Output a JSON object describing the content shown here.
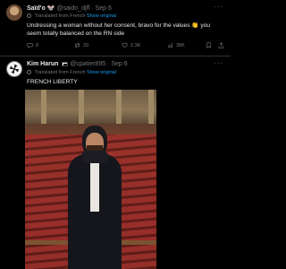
{
  "tweet1": {
    "name": "Saïd'o 🐭",
    "handle": "@saido_djff",
    "dot": "·",
    "date": "Sep 6",
    "translated": "Translated from French",
    "show_original": "Show original",
    "text": "Undressing a woman without her consent, bravo for the values 👏 you seem totally balanced on the RN side",
    "replies": "8",
    "retweets": "33",
    "likes": "2.3K",
    "views": "38K",
    "more": "···"
  },
  "tweet2": {
    "name": "Kim Harun",
    "handle": "@cpatier895",
    "dot": "·",
    "date": "Sep 6",
    "translated": "Translated from French",
    "show_original": "Show original",
    "text": "FRENCH LIBERTY",
    "more": "···"
  },
  "colors": {
    "accent": "#1d9bf0",
    "muted": "#71767b",
    "text": "#e7e9ea",
    "bg": "#000000"
  }
}
